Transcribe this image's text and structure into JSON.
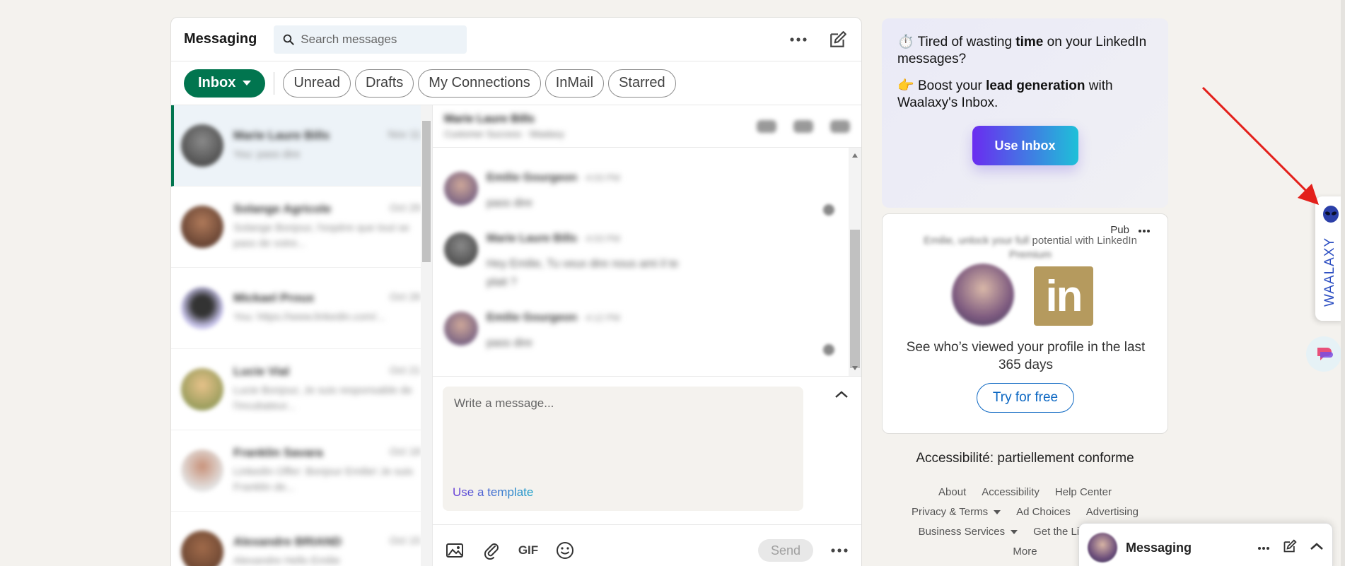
{
  "header": {
    "title": "Messaging",
    "search_placeholder": "Search messages"
  },
  "filters": {
    "inbox": "Inbox",
    "pills": [
      "Unread",
      "Drafts",
      "My Connections",
      "InMail",
      "Starred"
    ]
  },
  "conversations": [
    {
      "name": "Marie Laure Bills",
      "date": "Nov 11",
      "snippet": "You: pass dire"
    },
    {
      "name": "Solange Agricole",
      "date": "Oct 29",
      "snippet": "Solange Bonjour, l'espère que tout se pass de votre..."
    },
    {
      "name": "Mickael Proux",
      "date": "Oct 26",
      "snippet": "You: https://www.linkedin.com/..."
    },
    {
      "name": "Lucie Vial",
      "date": "Oct 21",
      "snippet": "Lucie Bonjour, Je suis responsable de l'incubateur..."
    },
    {
      "name": "Franklin Savara",
      "date": "Oct 18",
      "snippet": "LinkedIn Offer: Bonjour Emilie! Je suis Franklin de..."
    },
    {
      "name": "Alexandre BRIAND",
      "date": "Oct 15",
      "snippet": "Alexandre Hello Emilie"
    }
  ],
  "thread": {
    "name": "Marie Laure Bills",
    "subtitle": "Customer Success · Waalaxy",
    "messages": [
      {
        "name": "Emilie Gourgeon",
        "time": "· 4:03 PM",
        "text": "pass dire"
      },
      {
        "name": "Marie Laure Bills",
        "time": "· 4:03 PM",
        "text": "Hey Emilie, Tu veux dire nous ami il te plait ?"
      },
      {
        "name": "Emilie Gourgeon",
        "time": "· 4:12 PM",
        "text": "pass dire"
      }
    ]
  },
  "compose": {
    "placeholder": "Write a message...",
    "use_template": "Use a template",
    "send": "Send",
    "gif": "GIF"
  },
  "promo": {
    "line1_emoji": "⏱️",
    "line1_pre": "Tired of wasting ",
    "line1_bold": "time",
    "line1_post": " on your LinkedIn messages?",
    "line2_emoji": "👉",
    "line2_pre": "Boost your ",
    "line2_bold": "lead generation",
    "line2_post": " with Waalaxy's Inbox.",
    "button": "Use Inbox"
  },
  "ad": {
    "pub": "Pub",
    "tagline_blur": "Emilie, unlock your full",
    "tagline_clear": "potential with LinkedIn",
    "tagline_end": "Premium",
    "logo": "in",
    "description": "See who’s viewed your profile in the last 365 days",
    "button": "Try for free"
  },
  "accessibility": "Accessibilité: partiellement conforme",
  "footer": {
    "row1": [
      "About",
      "Accessibility",
      "Help Center"
    ],
    "row2": [
      "Privacy & Terms",
      "Ad Choices",
      "Advertising"
    ],
    "row3": [
      "Business Services",
      "Get the LinkedIn app"
    ],
    "row4": [
      "More"
    ]
  },
  "mini_messaging": {
    "title": "Messaging"
  },
  "waalaxy": {
    "label": "WAALAXY"
  },
  "colors": {
    "linkedin_green": "#01754f",
    "linkedin_blue": "#0a66c2",
    "waalaxy_blue": "#2d4fc2",
    "arrow_red": "#e3201b"
  }
}
